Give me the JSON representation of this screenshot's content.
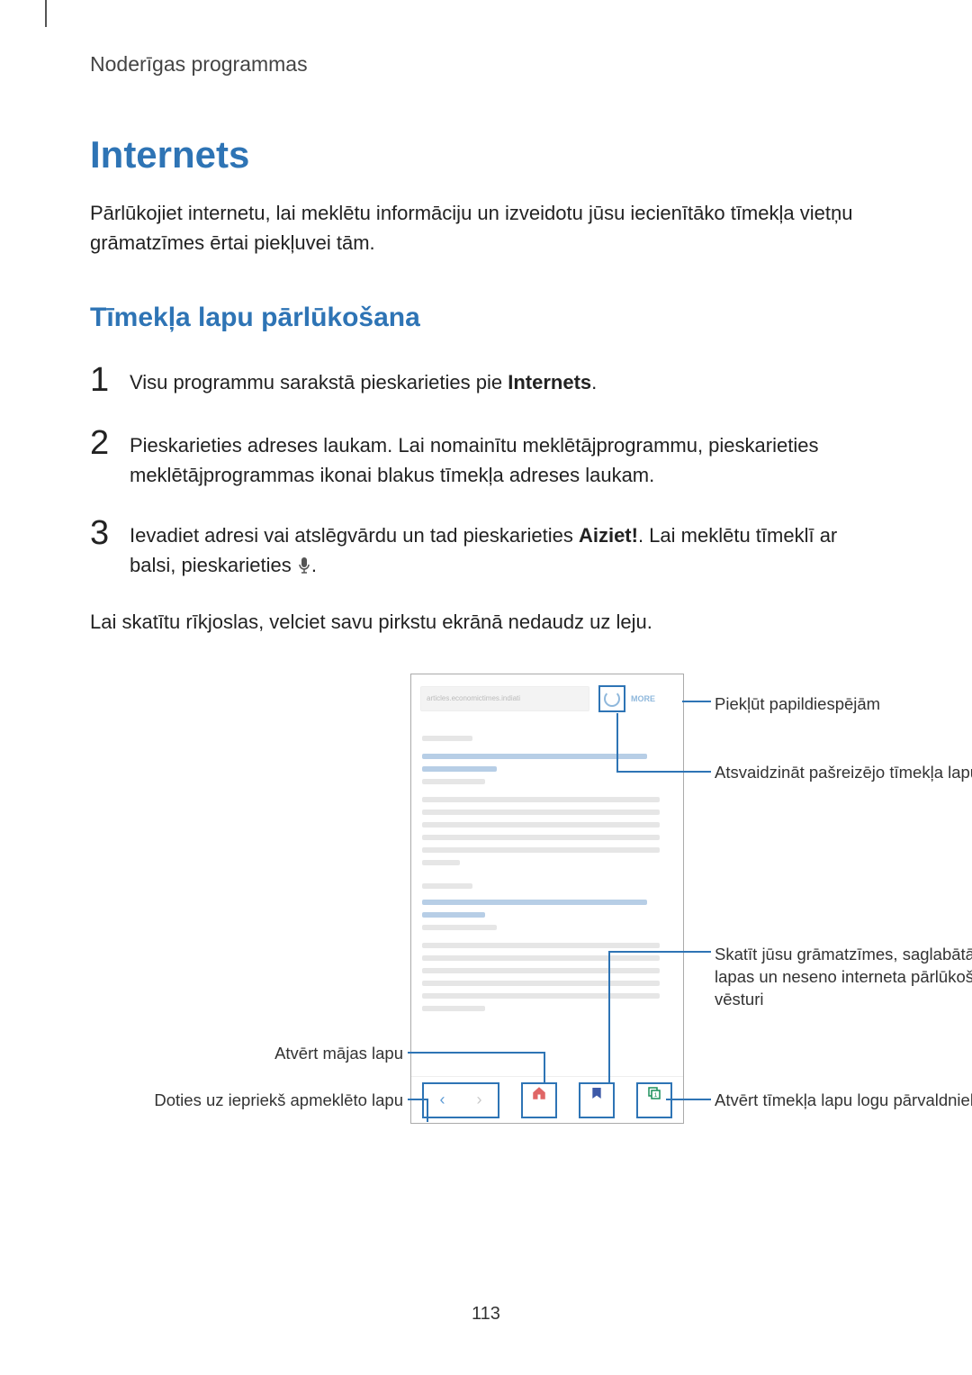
{
  "header": {
    "breadcrumb": "Noderīgas programmas"
  },
  "title": "Internets",
  "intro": "Pārlūkojiet internetu, lai meklētu informāciju un izveidotu jūsu iecienītāko tīmekļa vietņu grāmatzīmes ērtai piekļuvei tām.",
  "subtitle": "Tīmekļa lapu pārlūkošana",
  "steps": [
    {
      "num": "1",
      "pre": "Visu programmu sarakstā pieskarieties pie ",
      "bold": "Internets",
      "post": "."
    },
    {
      "num": "2",
      "text": "Pieskarieties adreses laukam. Lai nomainītu meklētājprogrammu, pieskarieties meklētājprogrammas ikonai blakus tīmekļa adreses laukam."
    },
    {
      "num": "3",
      "pre": "Ievadiet adresi vai atslēgvārdu un tad pieskarieties ",
      "bold": "Aiziet!",
      "post": ". Lai meklētu tīmeklī ar balsi, pieskarieties ",
      "trailing_icon": true,
      "tail": "."
    }
  ],
  "post_steps": "Lai skatītu rīkjoslas, velciet savu pirkstu ekrānā nedaudz uz leju.",
  "callouts": {
    "more_options": "Piekļūt papildiespējām",
    "refresh": "Atsvaidzināt pašreizējo tīmekļa lapu",
    "bookmarks": "Skatīt jūsu grāmatzīmes, saglabātās lapas un neseno interneta pārlūkošanas vēsturi",
    "tabs": "Atvērt tīmekļa lapu logu pārvaldnieku",
    "home": "Atvērt mājas lapu",
    "back": "Doties uz iepriekš apmeklēto lapu"
  },
  "phone": {
    "address_placeholder": "articles.economictimes.indiati",
    "more_label": "MORE"
  },
  "page_number": "113"
}
